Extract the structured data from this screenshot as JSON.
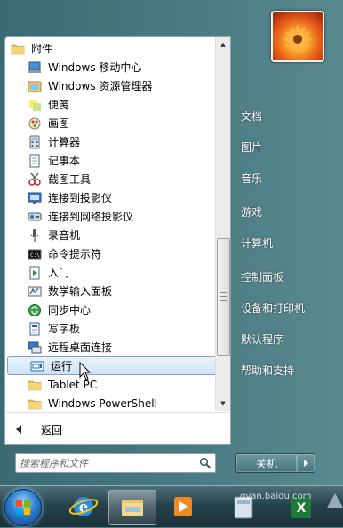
{
  "programs": {
    "items": [
      {
        "label": "附件",
        "icon": "folder-icon",
        "level": 0
      },
      {
        "label": "Windows 移动中心",
        "icon": "mobility-center-icon",
        "level": 1
      },
      {
        "label": "Windows 资源管理器",
        "icon": "explorer-icon",
        "level": 1
      },
      {
        "label": "便笺",
        "icon": "sticky-notes-icon",
        "level": 1
      },
      {
        "label": "画图",
        "icon": "paint-icon",
        "level": 1
      },
      {
        "label": "计算器",
        "icon": "calculator-icon",
        "level": 1
      },
      {
        "label": "记事本",
        "icon": "notepad-icon",
        "level": 1
      },
      {
        "label": "截图工具",
        "icon": "snipping-tool-icon",
        "level": 1
      },
      {
        "label": "连接到投影仪",
        "icon": "projector-icon",
        "level": 1
      },
      {
        "label": "连接到网络投影仪",
        "icon": "network-projector-icon",
        "level": 1
      },
      {
        "label": "录音机",
        "icon": "microphone-icon",
        "level": 1
      },
      {
        "label": "命令提示符",
        "icon": "command-prompt-icon",
        "level": 1
      },
      {
        "label": "入门",
        "icon": "getting-started-icon",
        "level": 1
      },
      {
        "label": "数学输入面板",
        "icon": "math-input-icon",
        "level": 1
      },
      {
        "label": "同步中心",
        "icon": "sync-center-icon",
        "level": 1
      },
      {
        "label": "写字板",
        "icon": "wordpad-icon",
        "level": 1
      },
      {
        "label": "远程桌面连接",
        "icon": "remote-desktop-icon",
        "level": 1
      },
      {
        "label": "运行",
        "icon": "run-icon",
        "level": 1,
        "selected": true
      },
      {
        "label": "Tablet PC",
        "icon": "folder-icon",
        "level": 1
      },
      {
        "label": "Windows PowerShell",
        "icon": "folder-icon",
        "level": 1
      }
    ],
    "back_label": "返回"
  },
  "search": {
    "placeholder": "搜索程序和文件"
  },
  "right_pane": {
    "items": [
      "文档",
      "图片",
      "音乐",
      "游戏",
      "计算机",
      "控制面板",
      "设备和打印机",
      "默认程序",
      "帮助和支持"
    ]
  },
  "shutdown": {
    "label": "关机"
  },
  "watermark": {
    "text": "gyan.baidu.com"
  },
  "colors": {
    "selection_border": "#7da2ce",
    "pane_bg": "#ffffff",
    "menu_bg": "#4c7c83"
  }
}
